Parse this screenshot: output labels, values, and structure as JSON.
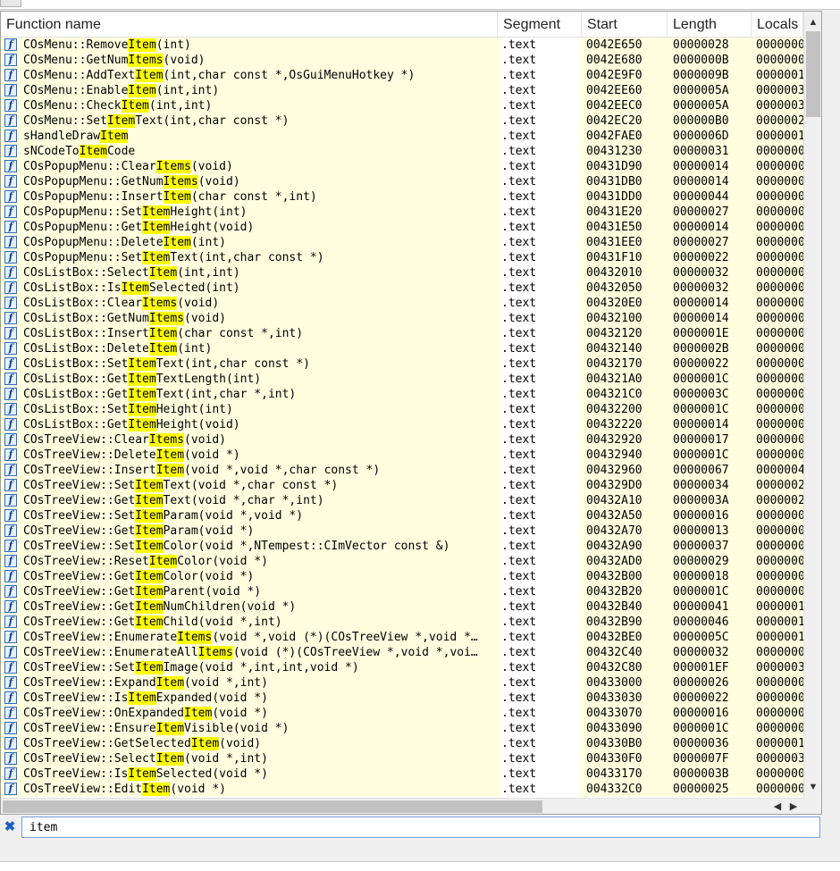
{
  "columns": {
    "name": "Function name",
    "segment": "Segment",
    "start": "Start",
    "length": "Length",
    "locals": "Locals"
  },
  "filter": {
    "value": "item"
  },
  "icons": {
    "function": "function-icon",
    "clear_filter": "close-icon"
  },
  "rows": [
    {
      "pre": "COsMenu::Remove",
      "hl": "Item",
      "post": "(int)",
      "segment": ".text",
      "start": "0042E650",
      "length": "00000028",
      "locals": "0000000"
    },
    {
      "pre": "COsMenu::GetNum",
      "hl": "Items",
      "post": "(void)",
      "segment": ".text",
      "start": "0042E680",
      "length": "0000000B",
      "locals": "0000000"
    },
    {
      "pre": "COsMenu::AddText",
      "hl": "Item",
      "post": "(int,char const *,OsGuiMenuHotkey *)",
      "segment": ".text",
      "start": "0042E9F0",
      "length": "0000009B",
      "locals": "0000001"
    },
    {
      "pre": "COsMenu::Enable",
      "hl": "Item",
      "post": "(int,int)",
      "segment": ".text",
      "start": "0042EE60",
      "length": "0000005A",
      "locals": "0000003"
    },
    {
      "pre": "COsMenu::Check",
      "hl": "Item",
      "post": "(int,int)",
      "segment": ".text",
      "start": "0042EEC0",
      "length": "0000005A",
      "locals": "0000003"
    },
    {
      "pre": "COsMenu::Set",
      "hl": "Item",
      "post": "Text(int,char const *)",
      "segment": ".text",
      "start": "0042EC20",
      "length": "000000B0",
      "locals": "0000002"
    },
    {
      "pre": "sHandleDraw",
      "hl": "Item",
      "post": "",
      "segment": ".text",
      "start": "0042FAE0",
      "length": "0000006D",
      "locals": "0000001"
    },
    {
      "pre": "sNCodeTo",
      "hl": "Item",
      "post": "Code",
      "segment": ".text",
      "start": "00431230",
      "length": "00000031",
      "locals": "0000000"
    },
    {
      "pre": "COsPopupMenu::Clear",
      "hl": "Items",
      "post": "(void)",
      "segment": ".text",
      "start": "00431D90",
      "length": "00000014",
      "locals": "0000000"
    },
    {
      "pre": "COsPopupMenu::GetNum",
      "hl": "Items",
      "post": "(void)",
      "segment": ".text",
      "start": "00431DB0",
      "length": "00000014",
      "locals": "0000000"
    },
    {
      "pre": "COsPopupMenu::Insert",
      "hl": "Item",
      "post": "(char const *,int)",
      "segment": ".text",
      "start": "00431DD0",
      "length": "00000044",
      "locals": "0000000"
    },
    {
      "pre": "COsPopupMenu::Set",
      "hl": "Item",
      "post": "Height(int)",
      "segment": ".text",
      "start": "00431E20",
      "length": "00000027",
      "locals": "0000000"
    },
    {
      "pre": "COsPopupMenu::Get",
      "hl": "Item",
      "post": "Height(void)",
      "segment": ".text",
      "start": "00431E50",
      "length": "00000014",
      "locals": "0000000"
    },
    {
      "pre": "COsPopupMenu::Delete",
      "hl": "Item",
      "post": "(int)",
      "segment": ".text",
      "start": "00431EE0",
      "length": "00000027",
      "locals": "0000000"
    },
    {
      "pre": "COsPopupMenu::Set",
      "hl": "Item",
      "post": "Text(int,char const *)",
      "segment": ".text",
      "start": "00431F10",
      "length": "00000022",
      "locals": "0000000"
    },
    {
      "pre": "COsListBox::Select",
      "hl": "Item",
      "post": "(int,int)",
      "segment": ".text",
      "start": "00432010",
      "length": "00000032",
      "locals": "0000000"
    },
    {
      "pre": "COsListBox::Is",
      "hl": "Item",
      "post": "Selected(int)",
      "segment": ".text",
      "start": "00432050",
      "length": "00000032",
      "locals": "0000000"
    },
    {
      "pre": "COsListBox::Clear",
      "hl": "Items",
      "post": "(void)",
      "segment": ".text",
      "start": "004320E0",
      "length": "00000014",
      "locals": "0000000"
    },
    {
      "pre": "COsListBox::GetNum",
      "hl": "Items",
      "post": "(void)",
      "segment": ".text",
      "start": "00432100",
      "length": "00000014",
      "locals": "0000000"
    },
    {
      "pre": "COsListBox::Insert",
      "hl": "Item",
      "post": "(char const *,int)",
      "segment": ".text",
      "start": "00432120",
      "length": "0000001E",
      "locals": "0000000"
    },
    {
      "pre": "COsListBox::Delete",
      "hl": "Item",
      "post": "(int)",
      "segment": ".text",
      "start": "00432140",
      "length": "0000002B",
      "locals": "0000000"
    },
    {
      "pre": "COsListBox::Set",
      "hl": "Item",
      "post": "Text(int,char const *)",
      "segment": ".text",
      "start": "00432170",
      "length": "00000022",
      "locals": "0000000"
    },
    {
      "pre": "COsListBox::Get",
      "hl": "Item",
      "post": "TextLength(int)",
      "segment": ".text",
      "start": "004321A0",
      "length": "0000001C",
      "locals": "0000000"
    },
    {
      "pre": "COsListBox::Get",
      "hl": "Item",
      "post": "Text(int,char *,int)",
      "segment": ".text",
      "start": "004321C0",
      "length": "0000003C",
      "locals": "0000000"
    },
    {
      "pre": "COsListBox::Set",
      "hl": "Item",
      "post": "Height(int)",
      "segment": ".text",
      "start": "00432200",
      "length": "0000001C",
      "locals": "0000000"
    },
    {
      "pre": "COsListBox::Get",
      "hl": "Item",
      "post": "Height(void)",
      "segment": ".text",
      "start": "00432220",
      "length": "00000014",
      "locals": "0000000"
    },
    {
      "pre": "COsTreeView::Clear",
      "hl": "Items",
      "post": "(void)",
      "segment": ".text",
      "start": "00432920",
      "length": "00000017",
      "locals": "0000000"
    },
    {
      "pre": "COsTreeView::Delete",
      "hl": "Item",
      "post": "(void *)",
      "segment": ".text",
      "start": "00432940",
      "length": "0000001C",
      "locals": "0000000"
    },
    {
      "pre": "COsTreeView::Insert",
      "hl": "Item",
      "post": "(void *,void *,char const *)",
      "segment": ".text",
      "start": "00432960",
      "length": "00000067",
      "locals": "0000004"
    },
    {
      "pre": "COsTreeView::Set",
      "hl": "Item",
      "post": "Text(void *,char const *)",
      "segment": ".text",
      "start": "004329D0",
      "length": "00000034",
      "locals": "0000002"
    },
    {
      "pre": "COsTreeView::Get",
      "hl": "Item",
      "post": "Text(void *,char *,int)",
      "segment": ".text",
      "start": "00432A10",
      "length": "0000003A",
      "locals": "0000002"
    },
    {
      "pre": "COsTreeView::Set",
      "hl": "Item",
      "post": "Param(void *,void *)",
      "segment": ".text",
      "start": "00432A50",
      "length": "00000016",
      "locals": "0000000"
    },
    {
      "pre": "COsTreeView::Get",
      "hl": "Item",
      "post": "Param(void *)",
      "segment": ".text",
      "start": "00432A70",
      "length": "00000013",
      "locals": "0000000"
    },
    {
      "pre": "COsTreeView::Set",
      "hl": "Item",
      "post": "Color(void *,NTempest::CImVector const &)",
      "segment": ".text",
      "start": "00432A90",
      "length": "00000037",
      "locals": "0000000"
    },
    {
      "pre": "COsTreeView::Reset",
      "hl": "Item",
      "post": "Color(void *)",
      "segment": ".text",
      "start": "00432AD0",
      "length": "00000029",
      "locals": "0000000"
    },
    {
      "pre": "COsTreeView::Get",
      "hl": "Item",
      "post": "Color(void *)",
      "segment": ".text",
      "start": "00432B00",
      "length": "00000018",
      "locals": "0000000"
    },
    {
      "pre": "COsTreeView::Get",
      "hl": "Item",
      "post": "Parent(void *)",
      "segment": ".text",
      "start": "00432B20",
      "length": "0000001C",
      "locals": "0000000"
    },
    {
      "pre": "COsTreeView::Get",
      "hl": "Item",
      "post": "NumChildren(void *)",
      "segment": ".text",
      "start": "00432B40",
      "length": "00000041",
      "locals": "0000001"
    },
    {
      "pre": "COsTreeView::Get",
      "hl": "Item",
      "post": "Child(void *,int)",
      "segment": ".text",
      "start": "00432B90",
      "length": "00000046",
      "locals": "0000001"
    },
    {
      "pre": "COsTreeView::Enumerate",
      "hl": "Items",
      "post": "(void *,void (*)(COsTreeView *,void *…",
      "segment": ".text",
      "start": "00432BE0",
      "length": "0000005C",
      "locals": "0000001"
    },
    {
      "pre": "COsTreeView::EnumerateAll",
      "hl": "Items",
      "post": "(void (*)(COsTreeView *,void *,voi…",
      "segment": ".text",
      "start": "00432C40",
      "length": "00000032",
      "locals": "0000000"
    },
    {
      "pre": "COsTreeView::Set",
      "hl": "Item",
      "post": "Image(void *,int,int,void *)",
      "segment": ".text",
      "start": "00432C80",
      "length": "000001EF",
      "locals": "0000003"
    },
    {
      "pre": "COsTreeView::Expand",
      "hl": "Item",
      "post": "(void *,int)",
      "segment": ".text",
      "start": "00433000",
      "length": "00000026",
      "locals": "0000000"
    },
    {
      "pre": "COsTreeView::Is",
      "hl": "Item",
      "post": "Expanded(void *)",
      "segment": ".text",
      "start": "00433030",
      "length": "00000022",
      "locals": "0000000"
    },
    {
      "pre": "COsTreeView::OnExpanded",
      "hl": "Item",
      "post": "(void *)",
      "segment": ".text",
      "start": "00433070",
      "length": "00000016",
      "locals": "0000000"
    },
    {
      "pre": "COsTreeView::Ensure",
      "hl": "Item",
      "post": "Visible(void *)",
      "segment": ".text",
      "start": "00433090",
      "length": "0000001C",
      "locals": "0000000"
    },
    {
      "pre": "COsTreeView::GetSelected",
      "hl": "Item",
      "post": "(void)",
      "segment": ".text",
      "start": "004330B0",
      "length": "00000036",
      "locals": "0000001"
    },
    {
      "pre": "COsTreeView::Select",
      "hl": "Item",
      "post": "(void *,int)",
      "segment": ".text",
      "start": "004330F0",
      "length": "0000007F",
      "locals": "0000003"
    },
    {
      "pre": "COsTreeView::Is",
      "hl": "Item",
      "post": "Selected(void *)",
      "segment": ".text",
      "start": "00433170",
      "length": "0000003B",
      "locals": "0000000"
    },
    {
      "pre": "COsTreeView::Edit",
      "hl": "Item",
      "post": "(void *)",
      "segment": ".text",
      "start": "004332C0",
      "length": "00000025",
      "locals": "0000000"
    }
  ]
}
